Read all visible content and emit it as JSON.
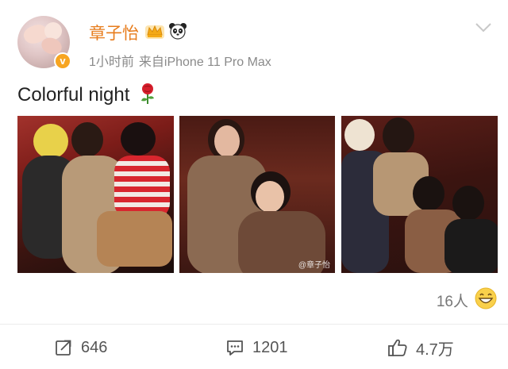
{
  "post": {
    "author": "章子怡",
    "meta_time": "1小时前",
    "meta_source": "来自iPhone 11 Pro Max",
    "text": "Colorful night",
    "watermark": "@章子怡"
  },
  "reactions": {
    "count": "16人"
  },
  "actions": {
    "repost_count": "646",
    "comment_count": "1201",
    "like_count": "4.7万"
  },
  "colors": {
    "name": "#e77c1c",
    "meta": "#8a8a8a",
    "verify": "#f7a521"
  },
  "icons": [
    "crown-icon",
    "panda-icon",
    "chevron-down-icon",
    "rose-icon",
    "grin-emoji-icon",
    "repost-icon",
    "comment-icon",
    "like-icon",
    "verified-badge-icon"
  ]
}
